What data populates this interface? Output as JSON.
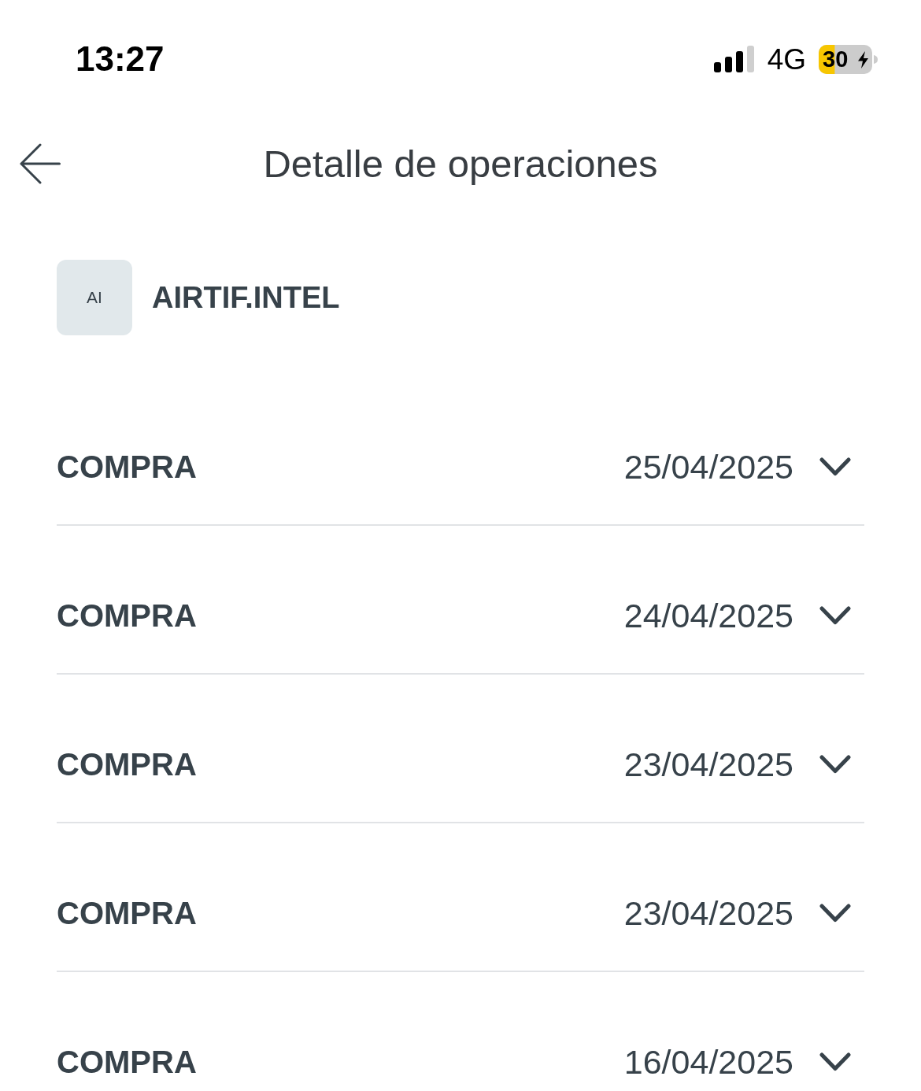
{
  "status_bar": {
    "time": "13:27",
    "network": "4G",
    "battery": {
      "label": "30",
      "charging": true
    }
  },
  "header": {
    "title": "Detalle de operaciones"
  },
  "merchant": {
    "initials": "AI",
    "name": "AIRTIF.INTEL"
  },
  "operations": [
    {
      "label": "COMPRA",
      "date": "25/04/2025",
      "expanded": false
    },
    {
      "label": "COMPRA",
      "date": "24/04/2025",
      "expanded": false
    },
    {
      "label": "COMPRA",
      "date": "23/04/2025",
      "expanded": false
    },
    {
      "label": "COMPRA",
      "date": "23/04/2025",
      "expanded": false
    },
    {
      "label": "COMPRA",
      "date": "16/04/2025",
      "expanded": false
    }
  ]
}
